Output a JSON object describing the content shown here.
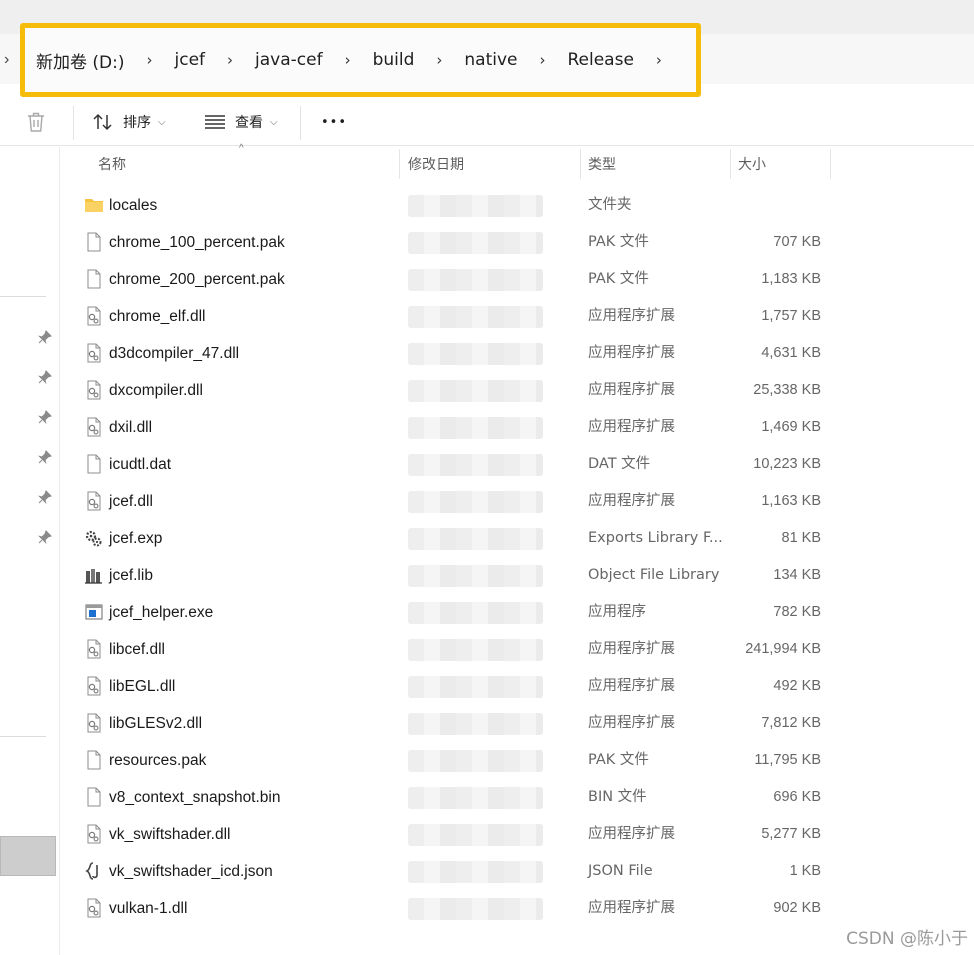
{
  "breadcrumbs": [
    "新加卷 (D:)",
    "jcef",
    "java-cef",
    "build",
    "native",
    "Release"
  ],
  "toolbar": {
    "sort_label": "排序",
    "view_label": "查看",
    "more_label": "•••"
  },
  "columns": {
    "name": "名称",
    "date": "修改日期",
    "type": "类型",
    "size": "大小"
  },
  "files": [
    {
      "name": "locales",
      "type": "文件夹",
      "size": "",
      "icon": "folder-icon"
    },
    {
      "name": "chrome_100_percent.pak",
      "type": "PAK 文件",
      "size": "707 KB",
      "icon": "file-icon"
    },
    {
      "name": "chrome_200_percent.pak",
      "type": "PAK 文件",
      "size": "1,183 KB",
      "icon": "file-icon"
    },
    {
      "name": "chrome_elf.dll",
      "type": "应用程序扩展",
      "size": "1,757 KB",
      "icon": "dll-icon"
    },
    {
      "name": "d3dcompiler_47.dll",
      "type": "应用程序扩展",
      "size": "4,631 KB",
      "icon": "dll-icon"
    },
    {
      "name": "dxcompiler.dll",
      "type": "应用程序扩展",
      "size": "25,338 KB",
      "icon": "dll-icon"
    },
    {
      "name": "dxil.dll",
      "type": "应用程序扩展",
      "size": "1,469 KB",
      "icon": "dll-icon"
    },
    {
      "name": "icudtl.dat",
      "type": "DAT 文件",
      "size": "10,223 KB",
      "icon": "file-icon"
    },
    {
      "name": "jcef.dll",
      "type": "应用程序扩展",
      "size": "1,163 KB",
      "icon": "dll-icon"
    },
    {
      "name": "jcef.exp",
      "type": "Exports Library F...",
      "size": "81 KB",
      "icon": "exp-icon"
    },
    {
      "name": "jcef.lib",
      "type": "Object File Library",
      "size": "134 KB",
      "icon": "lib-icon"
    },
    {
      "name": "jcef_helper.exe",
      "type": "应用程序",
      "size": "782 KB",
      "icon": "exe-icon"
    },
    {
      "name": "libcef.dll",
      "type": "应用程序扩展",
      "size": "241,994 KB",
      "icon": "dll-icon"
    },
    {
      "name": "libEGL.dll",
      "type": "应用程序扩展",
      "size": "492 KB",
      "icon": "dll-icon"
    },
    {
      "name": "libGLESv2.dll",
      "type": "应用程序扩展",
      "size": "7,812 KB",
      "icon": "dll-icon"
    },
    {
      "name": "resources.pak",
      "type": "PAK 文件",
      "size": "11,795 KB",
      "icon": "file-icon"
    },
    {
      "name": "v8_context_snapshot.bin",
      "type": "BIN 文件",
      "size": "696 KB",
      "icon": "file-icon"
    },
    {
      "name": "vk_swiftshader.dll",
      "type": "应用程序扩展",
      "size": "5,277 KB",
      "icon": "dll-icon"
    },
    {
      "name": "vk_swiftshader_icd.json",
      "type": "JSON File",
      "size": "1 KB",
      "icon": "json-icon"
    },
    {
      "name": "vulkan-1.dll",
      "type": "应用程序扩展",
      "size": "902 KB",
      "icon": "dll-icon"
    }
  ],
  "watermark": "CSDN @陈小于",
  "colors": {
    "highlight": "#f5bd0a",
    "folder": "#f6c443"
  }
}
